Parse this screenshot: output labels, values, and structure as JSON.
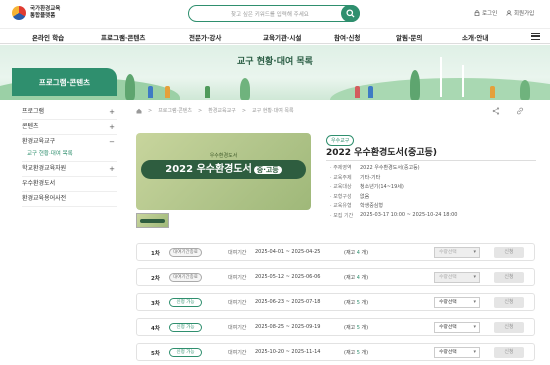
{
  "logo": {
    "line1": "국가환경교육",
    "line2": "통합플랫폼"
  },
  "search": {
    "placeholder": "찾고 싶은 키워드를 입력해 주세요"
  },
  "util": {
    "login": "로그인",
    "signup": "회원가입"
  },
  "gnb": [
    "온라인 학습",
    "프로그램·콘텐츠",
    "전문가·강사",
    "교육기관·시설",
    "참여·신청",
    "알림·문의",
    "소개·안내"
  ],
  "banner": {
    "title": "교구 현황·대여 목록"
  },
  "sidebar": {
    "title": "프로그램·콘텐츠",
    "items": [
      {
        "label": "프로그램",
        "toggle": "+"
      },
      {
        "label": "콘텐츠",
        "toggle": "+"
      },
      {
        "label": "환경교육교구",
        "toggle": "−"
      },
      {
        "label": "학교환경교육자원",
        "toggle": "+"
      },
      {
        "label": "우수환경도서",
        "toggle": ""
      },
      {
        "label": "환경교육용어사전",
        "toggle": ""
      }
    ],
    "sub": "교구 현황·대여 목록"
  },
  "breadcrumb": [
    "프로그램·콘텐츠",
    "환경교육교구",
    "교구 현황·대여 목록"
  ],
  "product": {
    "img_sub": "우수환경도서",
    "img_main": "2022 우수환경도서",
    "img_badge": "중·고등",
    "tag": "우수교구",
    "title": "2022 우수환경도서(중고등)",
    "info": [
      {
        "k": "주제영역",
        "v": "2022 우수환경도서(중고등)"
      },
      {
        "k": "교육주제",
        "v": "기타-기타"
      },
      {
        "k": "교육대상",
        "v": "청소년기(14~19세)"
      },
      {
        "k": "모형구성",
        "v": "없음"
      },
      {
        "k": "교육유형",
        "v": "학생중심형"
      },
      {
        "k": "모집 기간",
        "v": "2025-03-17 10:00 ~ 2025-10-24 18:00"
      }
    ]
  },
  "rounds": [
    {
      "no": "1차",
      "status": "대여기간종료",
      "label": "대여기간",
      "date": "2025-04-01 ~ 2025-04-25",
      "stock_pre": "(재고 ",
      "stock": "4",
      "stock_post": " 개)",
      "select": "수량선택",
      "button": "신청"
    },
    {
      "no": "2차",
      "status": "대여기간종료",
      "label": "대여기간",
      "date": "2025-05-12 ~ 2025-06-06",
      "stock_pre": "(재고 ",
      "stock": "4",
      "stock_post": " 개)",
      "select": "수량선택",
      "button": "신청"
    },
    {
      "no": "3차",
      "status": "신청 가능",
      "label": "대여기간",
      "date": "2025-06-23 ~ 2025-07-18",
      "stock_pre": "(재고 ",
      "stock": "5",
      "stock_post": " 개)",
      "select": "수량선택",
      "button": "신청"
    },
    {
      "no": "4차",
      "status": "신청 가능",
      "label": "대여기간",
      "date": "2025-08-25 ~ 2025-09-19",
      "stock_pre": "(재고 ",
      "stock": "5",
      "stock_post": " 개)",
      "select": "수량선택",
      "button": "신청"
    },
    {
      "no": "5차",
      "status": "신청 가능",
      "label": "대여기간",
      "date": "2025-10-20 ~ 2025-11-14",
      "stock_pre": "(재고 ",
      "stock": "5",
      "stock_post": " 개)",
      "select": "수량선택",
      "button": "신청"
    }
  ],
  "colors": {
    "brand": "#2f8f6e"
  }
}
